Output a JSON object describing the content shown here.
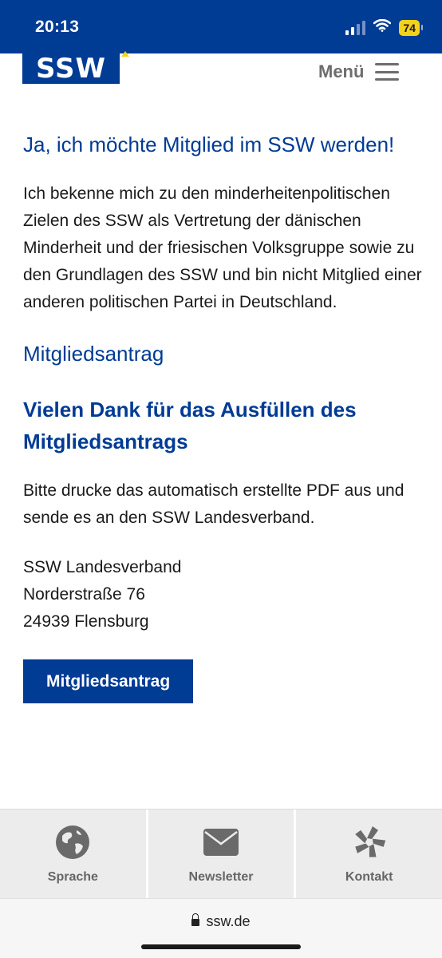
{
  "status_bar": {
    "time": "20:13",
    "battery": "74"
  },
  "header": {
    "logo_text": "SSW",
    "menu_label": "Menü"
  },
  "main": {
    "intro_heading": "Ja, ich möchte Mitglied im SSW werden!",
    "intro_text": "Ich bekenne mich zu den minderheitenpolitischen Zielen des SSW als Vertretung der dänischen Minderheit und der friesischen Volksgruppe sowie zu den Grundlagen des SSW und bin nicht Mitglied einer anderen politischen Partei in Deutschland.",
    "section_link": "Mitgliedsantrag",
    "thanks_heading": "Vielen Dank für das Ausfüllen des Mitgliedsantrags",
    "print_text": "Bitte drucke das automatisch erstellte PDF aus und sende es an den SSW Landesverband.",
    "address": {
      "line1": "SSW Landesverband",
      "line2": "Norderstraße 76",
      "line3": "24939 Flensburg"
    },
    "cta_label": "Mitgliedsantrag"
  },
  "bottom_bar": {
    "items": [
      {
        "label": "Sprache",
        "icon": "globe-icon"
      },
      {
        "label": "Newsletter",
        "icon": "envelope-icon"
      },
      {
        "label": "Kontakt",
        "icon": "pinwheel-icon"
      }
    ]
  },
  "browser": {
    "url": "ssw.de"
  },
  "colors": {
    "brand": "#003b94",
    "accent": "#f4d21a",
    "bottom_bar_bg": "#ececec"
  }
}
